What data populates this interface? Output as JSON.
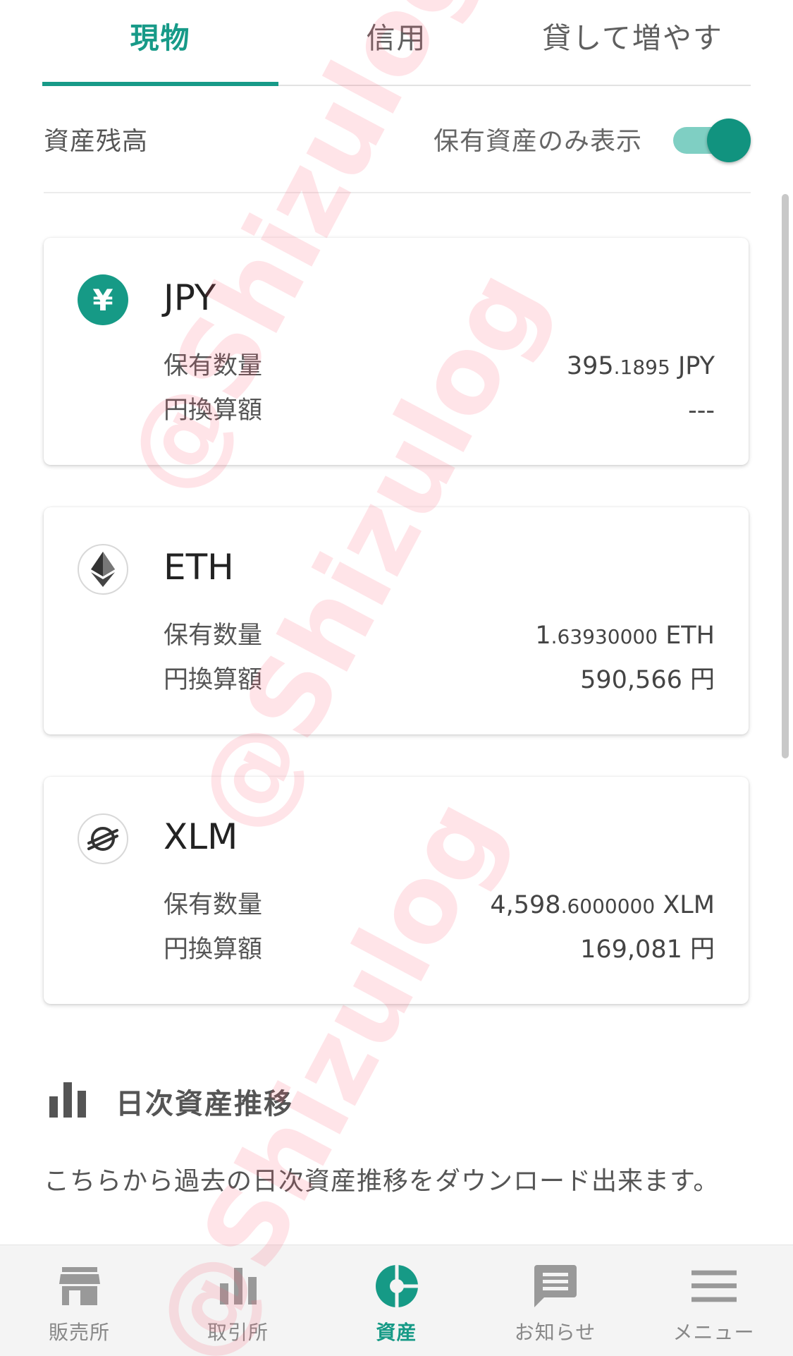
{
  "tabs": [
    {
      "label": "現物",
      "active": true
    },
    {
      "label": "信用",
      "active": false
    },
    {
      "label": "貸して増やす",
      "active": false
    }
  ],
  "balance": {
    "title": "資産残高",
    "toggle_label": "保有資産のみ表示",
    "toggle_on": true
  },
  "assets": [
    {
      "code": "JPY",
      "icon": "yen-icon",
      "icon_glyph": "¥",
      "holding_label": "保有数量",
      "holding_int": "395",
      "holding_dec": ".1895",
      "holding_unit": " JPY",
      "jpy_label": "円換算額",
      "jpy_value": "---"
    },
    {
      "code": "ETH",
      "icon": "ethereum-icon",
      "holding_label": "保有数量",
      "holding_int": "1",
      "holding_dec": ".63930000",
      "holding_unit": " ETH",
      "jpy_label": "円換算額",
      "jpy_value": "590,566 円"
    },
    {
      "code": "XLM",
      "icon": "stellar-icon",
      "holding_label": "保有数量",
      "holding_int": "4,598",
      "holding_dec": ".6000000",
      "holding_unit": " XLM",
      "jpy_label": "円換算額",
      "jpy_value": "169,081 円"
    }
  ],
  "daily": {
    "title": "日次資産推移",
    "description": "こちらから過去の日次資産推移をダウンロード出来ます。"
  },
  "nav": [
    {
      "label": "販売所",
      "icon": "store-icon",
      "active": false
    },
    {
      "label": "取引所",
      "icon": "bar-chart-icon",
      "active": false
    },
    {
      "label": "資産",
      "icon": "asset-pie-icon",
      "active": true
    },
    {
      "label": "お知らせ",
      "icon": "message-icon",
      "active": false
    },
    {
      "label": "メニュー",
      "icon": "menu-icon",
      "active": false
    }
  ],
  "watermark": "@Shizulog",
  "colors": {
    "accent": "#179a88",
    "toggle_track": "#7fcfc3",
    "nav_bg": "#f4f4f4",
    "watermark": "#ff5a6e"
  }
}
